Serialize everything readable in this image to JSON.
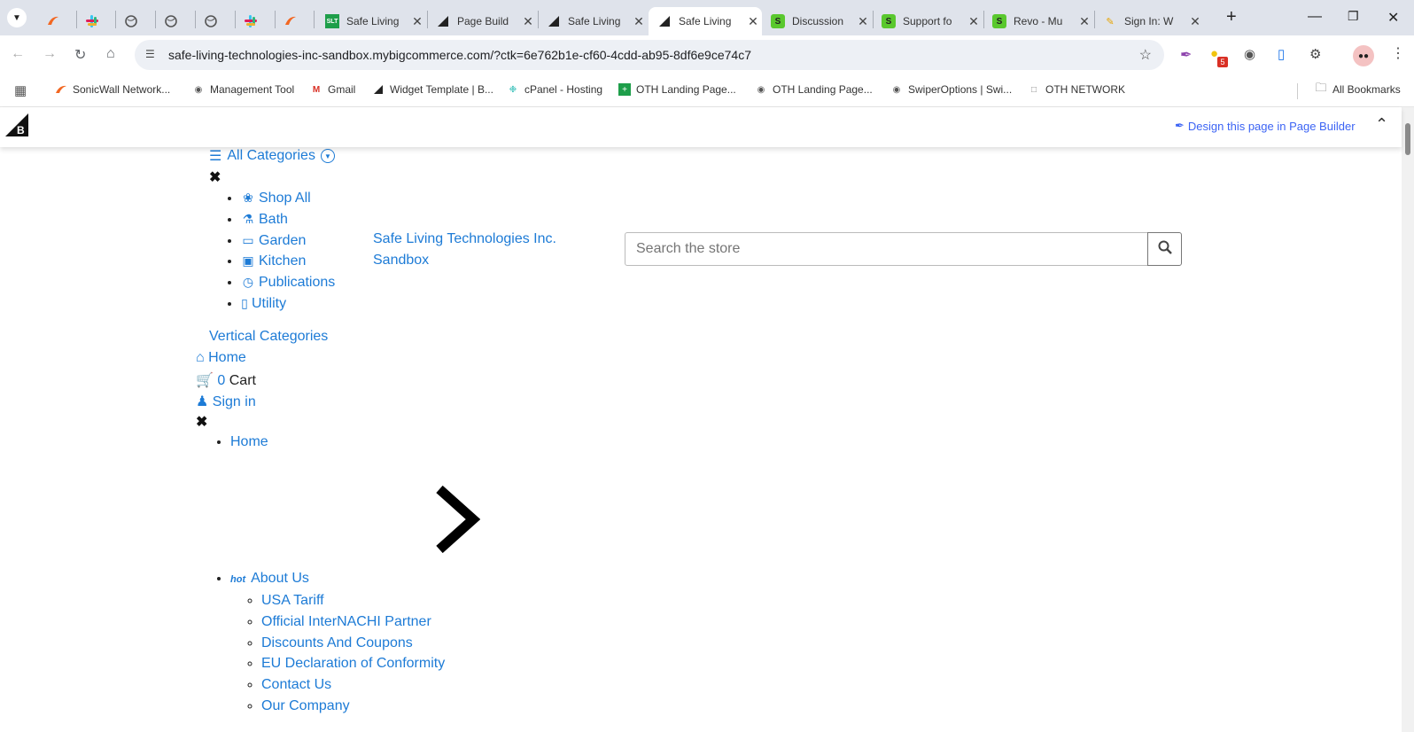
{
  "browser": {
    "tabs": [
      {
        "title": "",
        "icon": "sonicwall-icon"
      },
      {
        "title": "",
        "icon": "slack-icon"
      },
      {
        "title": "",
        "icon": "globe-icon"
      },
      {
        "title": "",
        "icon": "globe-icon"
      },
      {
        "title": "",
        "icon": "globe-icon"
      },
      {
        "title": "",
        "icon": "slack-icon"
      },
      {
        "title": "",
        "icon": "sonicwall-icon"
      },
      {
        "title": "Safe Living",
        "icon": "slt-icon"
      },
      {
        "title": "Page Build",
        "icon": "bigcommerce-icon"
      },
      {
        "title": "Safe Living",
        "icon": "bigcommerce-icon"
      },
      {
        "title": "Safe Living",
        "icon": "bigcommerce-icon",
        "active": true
      },
      {
        "title": "Discussion",
        "icon": "green-s-icon"
      },
      {
        "title": "Support fo",
        "icon": "green-s-icon"
      },
      {
        "title": "Revo - Mu",
        "icon": "green-s-icon"
      },
      {
        "title": "Sign In: W",
        "icon": "pencil-icon"
      }
    ],
    "url": "safe-living-technologies-inc-sandbox.mybigcommerce.com/?ctk=6e762b1e-cf60-4cdd-ab95-8df6e9ce74c7",
    "extension_badge": "5",
    "bookmarks": [
      {
        "label": "SonicWall Network...",
        "icon": "sonicwall-icon"
      },
      {
        "label": "Management Tool",
        "icon": "globe-icon"
      },
      {
        "label": "Gmail",
        "icon": "gmail-icon"
      },
      {
        "label": "Widget Template | B...",
        "icon": "bigcommerce-icon"
      },
      {
        "label": "cPanel - Hosting",
        "icon": "cpanel-icon"
      },
      {
        "label": "OTH Landing Page...",
        "icon": "sheets-icon"
      },
      {
        "label": "OTH Landing Page...",
        "icon": "globe-icon"
      },
      {
        "label": "SwiperOptions | Swi...",
        "icon": "globe-icon"
      },
      {
        "label": "OTH NETWORK",
        "icon": "page-icon"
      }
    ],
    "all_bookmarks": "All Bookmarks"
  },
  "bc_bar": {
    "design_link": "Design this page in Page Builder"
  },
  "page": {
    "all_categories": "All Categories",
    "categories": [
      {
        "label": "Shop All",
        "icon": "leaf-icon"
      },
      {
        "label": "Bath",
        "icon": "cutlery-icon"
      },
      {
        "label": "Garden",
        "icon": "monitor-icon"
      },
      {
        "label": "Kitchen",
        "icon": "briefcase-icon"
      },
      {
        "label": "Publications",
        "icon": "clock-icon"
      },
      {
        "label": "Utility",
        "icon": "mobile-icon"
      }
    ],
    "vertical_categories": "Vertical Categories",
    "store_name": "Safe Living Technologies Inc. Sandbox",
    "search_placeholder": "Search the store",
    "home": "Home",
    "cart_count": "0",
    "cart_label": "Cart",
    "sign_in": "Sign in",
    "menu_home": "Home",
    "hot_badge": "hot",
    "about_us": "About Us",
    "about_children": [
      "USA Tariff",
      "Official InterNACHI Partner",
      "Discounts And Coupons",
      "EU Declaration of Conformity",
      "Contact Us",
      "Our Company"
    ]
  },
  "colors": {
    "link": "#1d7bd6",
    "tab_bar": "#dfe3eb"
  }
}
